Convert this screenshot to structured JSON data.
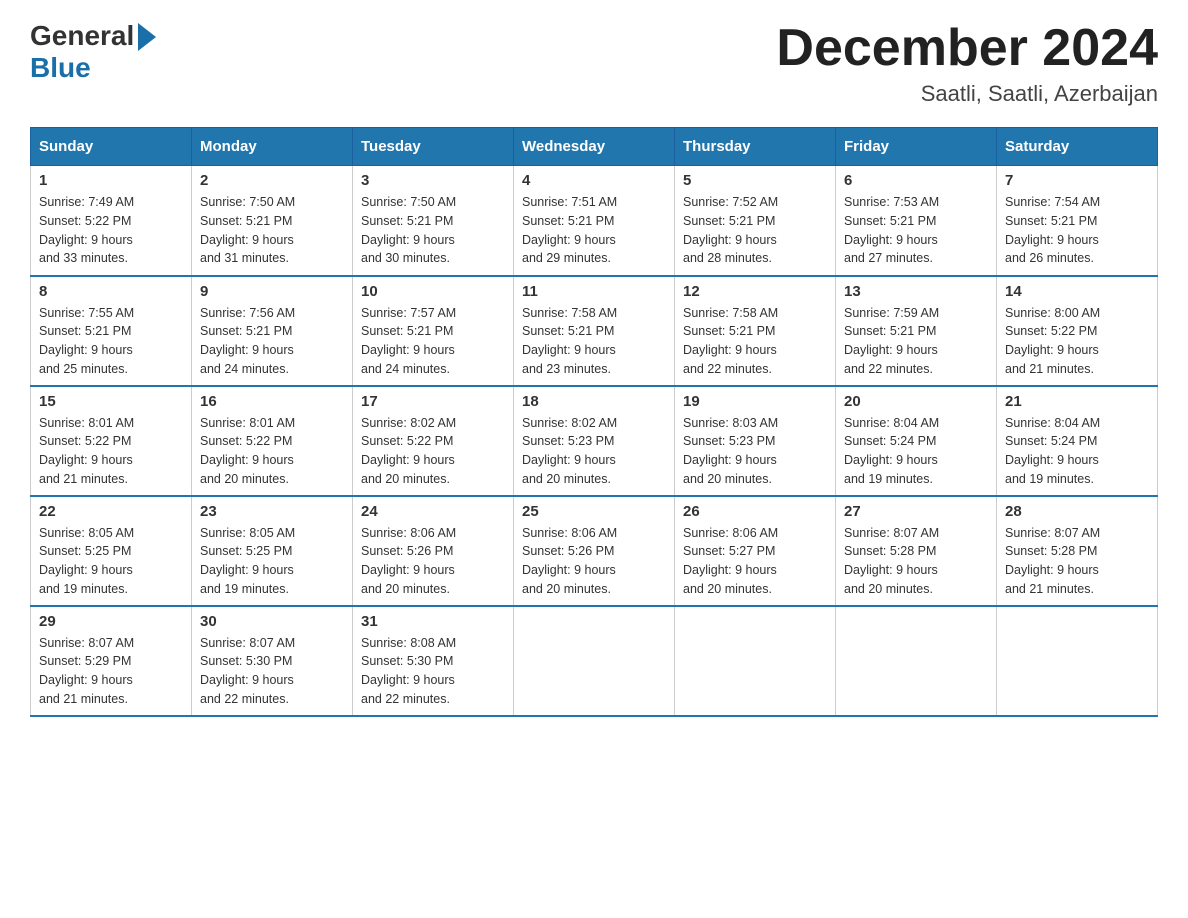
{
  "logo": {
    "general": "General",
    "blue": "Blue"
  },
  "title": "December 2024",
  "subtitle": "Saatli, Saatli, Azerbaijan",
  "days_of_week": [
    "Sunday",
    "Monday",
    "Tuesday",
    "Wednesday",
    "Thursday",
    "Friday",
    "Saturday"
  ],
  "weeks": [
    [
      {
        "day": "1",
        "info": "Sunrise: 7:49 AM\nSunset: 5:22 PM\nDaylight: 9 hours\nand 33 minutes."
      },
      {
        "day": "2",
        "info": "Sunrise: 7:50 AM\nSunset: 5:21 PM\nDaylight: 9 hours\nand 31 minutes."
      },
      {
        "day": "3",
        "info": "Sunrise: 7:50 AM\nSunset: 5:21 PM\nDaylight: 9 hours\nand 30 minutes."
      },
      {
        "day": "4",
        "info": "Sunrise: 7:51 AM\nSunset: 5:21 PM\nDaylight: 9 hours\nand 29 minutes."
      },
      {
        "day": "5",
        "info": "Sunrise: 7:52 AM\nSunset: 5:21 PM\nDaylight: 9 hours\nand 28 minutes."
      },
      {
        "day": "6",
        "info": "Sunrise: 7:53 AM\nSunset: 5:21 PM\nDaylight: 9 hours\nand 27 minutes."
      },
      {
        "day": "7",
        "info": "Sunrise: 7:54 AM\nSunset: 5:21 PM\nDaylight: 9 hours\nand 26 minutes."
      }
    ],
    [
      {
        "day": "8",
        "info": "Sunrise: 7:55 AM\nSunset: 5:21 PM\nDaylight: 9 hours\nand 25 minutes."
      },
      {
        "day": "9",
        "info": "Sunrise: 7:56 AM\nSunset: 5:21 PM\nDaylight: 9 hours\nand 24 minutes."
      },
      {
        "day": "10",
        "info": "Sunrise: 7:57 AM\nSunset: 5:21 PM\nDaylight: 9 hours\nand 24 minutes."
      },
      {
        "day": "11",
        "info": "Sunrise: 7:58 AM\nSunset: 5:21 PM\nDaylight: 9 hours\nand 23 minutes."
      },
      {
        "day": "12",
        "info": "Sunrise: 7:58 AM\nSunset: 5:21 PM\nDaylight: 9 hours\nand 22 minutes."
      },
      {
        "day": "13",
        "info": "Sunrise: 7:59 AM\nSunset: 5:21 PM\nDaylight: 9 hours\nand 22 minutes."
      },
      {
        "day": "14",
        "info": "Sunrise: 8:00 AM\nSunset: 5:22 PM\nDaylight: 9 hours\nand 21 minutes."
      }
    ],
    [
      {
        "day": "15",
        "info": "Sunrise: 8:01 AM\nSunset: 5:22 PM\nDaylight: 9 hours\nand 21 minutes."
      },
      {
        "day": "16",
        "info": "Sunrise: 8:01 AM\nSunset: 5:22 PM\nDaylight: 9 hours\nand 20 minutes."
      },
      {
        "day": "17",
        "info": "Sunrise: 8:02 AM\nSunset: 5:22 PM\nDaylight: 9 hours\nand 20 minutes."
      },
      {
        "day": "18",
        "info": "Sunrise: 8:02 AM\nSunset: 5:23 PM\nDaylight: 9 hours\nand 20 minutes."
      },
      {
        "day": "19",
        "info": "Sunrise: 8:03 AM\nSunset: 5:23 PM\nDaylight: 9 hours\nand 20 minutes."
      },
      {
        "day": "20",
        "info": "Sunrise: 8:04 AM\nSunset: 5:24 PM\nDaylight: 9 hours\nand 19 minutes."
      },
      {
        "day": "21",
        "info": "Sunrise: 8:04 AM\nSunset: 5:24 PM\nDaylight: 9 hours\nand 19 minutes."
      }
    ],
    [
      {
        "day": "22",
        "info": "Sunrise: 8:05 AM\nSunset: 5:25 PM\nDaylight: 9 hours\nand 19 minutes."
      },
      {
        "day": "23",
        "info": "Sunrise: 8:05 AM\nSunset: 5:25 PM\nDaylight: 9 hours\nand 19 minutes."
      },
      {
        "day": "24",
        "info": "Sunrise: 8:06 AM\nSunset: 5:26 PM\nDaylight: 9 hours\nand 20 minutes."
      },
      {
        "day": "25",
        "info": "Sunrise: 8:06 AM\nSunset: 5:26 PM\nDaylight: 9 hours\nand 20 minutes."
      },
      {
        "day": "26",
        "info": "Sunrise: 8:06 AM\nSunset: 5:27 PM\nDaylight: 9 hours\nand 20 minutes."
      },
      {
        "day": "27",
        "info": "Sunrise: 8:07 AM\nSunset: 5:28 PM\nDaylight: 9 hours\nand 20 minutes."
      },
      {
        "day": "28",
        "info": "Sunrise: 8:07 AM\nSunset: 5:28 PM\nDaylight: 9 hours\nand 21 minutes."
      }
    ],
    [
      {
        "day": "29",
        "info": "Sunrise: 8:07 AM\nSunset: 5:29 PM\nDaylight: 9 hours\nand 21 minutes."
      },
      {
        "day": "30",
        "info": "Sunrise: 8:07 AM\nSunset: 5:30 PM\nDaylight: 9 hours\nand 22 minutes."
      },
      {
        "day": "31",
        "info": "Sunrise: 8:08 AM\nSunset: 5:30 PM\nDaylight: 9 hours\nand 22 minutes."
      },
      {
        "day": "",
        "info": ""
      },
      {
        "day": "",
        "info": ""
      },
      {
        "day": "",
        "info": ""
      },
      {
        "day": "",
        "info": ""
      }
    ]
  ]
}
